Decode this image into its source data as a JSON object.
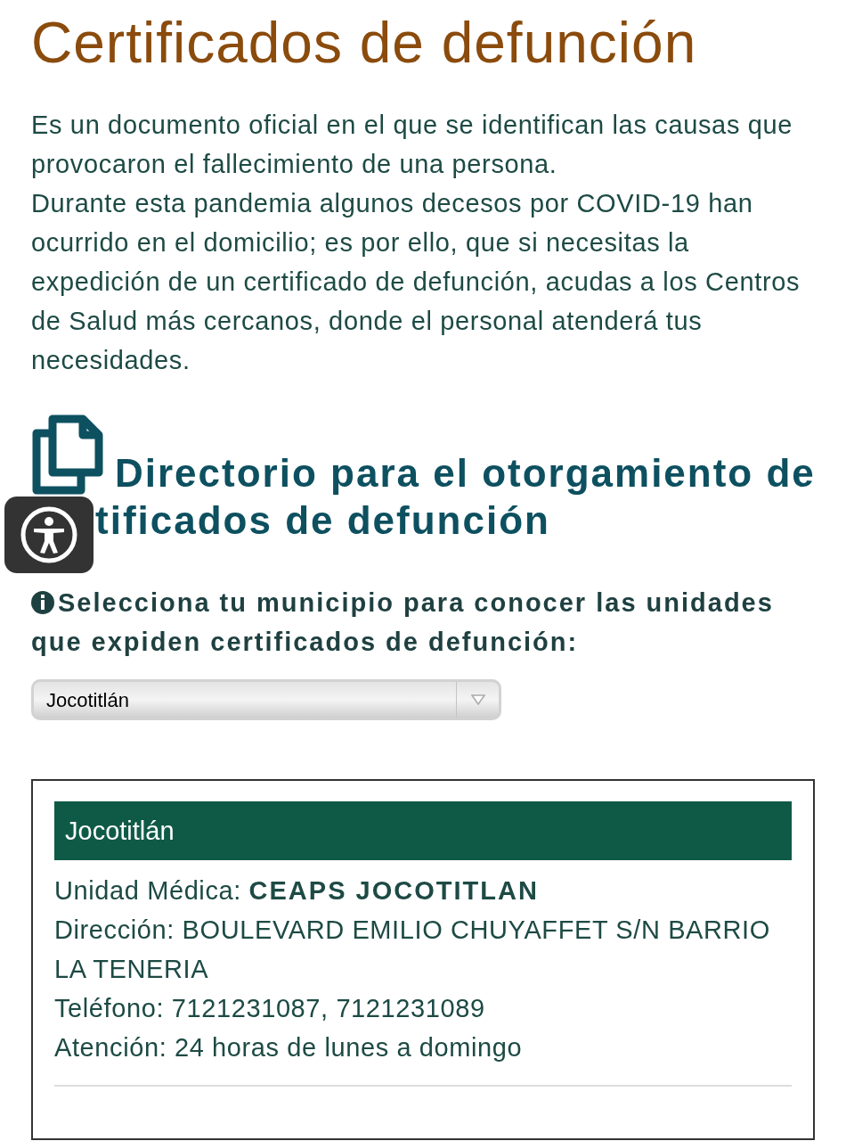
{
  "title": "Certificados de defunción",
  "intro": [
    "Es un documento oficial en el que se identifican las causas que provocaron el fallecimiento de una persona.",
    "Durante esta pandemia algunos decesos por COVID-19 han ocurrido en el domicilio; es por ello, que si necesitas la expedición de un certificado de defunción, acudas a los Centros de Salud más cercanos, donde el personal atenderá tus necesidades."
  ],
  "directory": {
    "heading_line_1": "Directorio para el otorgamiento de",
    "heading_line_2": "tificados de defunción",
    "prompt": "Selecciona tu municipio para conocer las unidades que expiden certificados de defunción:",
    "select_value": "Jocotitlán"
  },
  "card": {
    "header": "Jocotitlán",
    "fields": [
      {
        "label": "Unidad Médica:",
        "value": "CEAPS JOCOTITLAN",
        "bold": true
      },
      {
        "label": "Dirección:",
        "value": "BOULEVARD EMILIO CHUYAFFET S/N BARRIO LA TENERIA",
        "bold": false
      },
      {
        "label": "Teléfono:",
        "value": "7121231087, 7121231089",
        "bold": false
      },
      {
        "label": "Atención:",
        "value": "24 horas de lunes a domingo",
        "bold": false
      }
    ]
  }
}
